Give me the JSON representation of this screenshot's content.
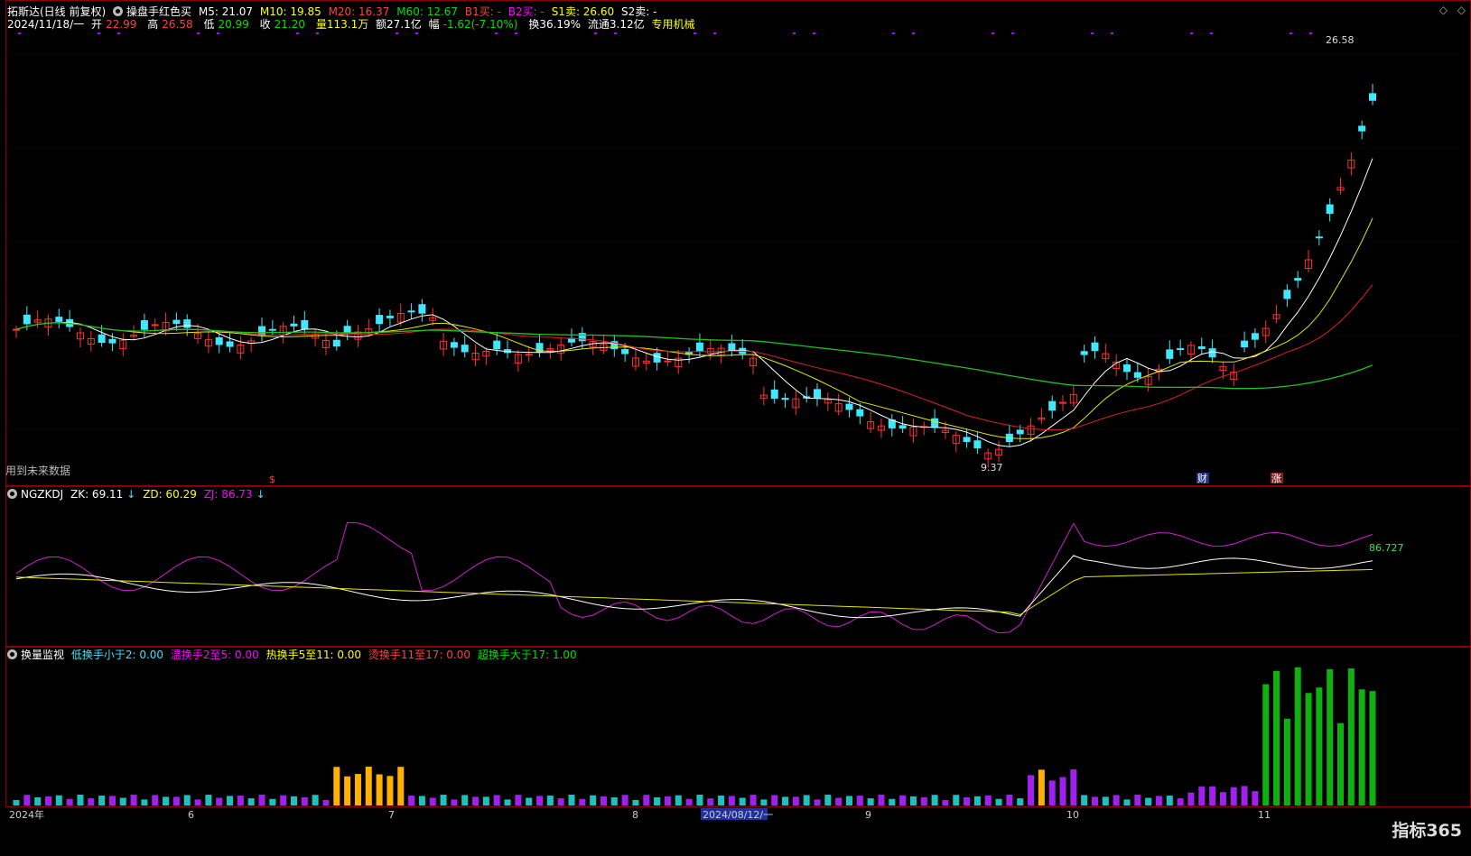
{
  "header": {
    "stock": "拓斯达(日线 前复权)",
    "indicator": "操盘手红色买",
    "m5": "M5: 21.07",
    "m10": "M10: 19.85",
    "m20": "M20: 16.37",
    "m60": "M60: 12.67",
    "b1": "B1买: -",
    "b2": "B2买: -",
    "s1": "S1卖: 26.60",
    "s2": "S2卖: -",
    "date": "2024/11/18/一",
    "open_label": "开",
    "open": "22.99",
    "high_label": "高",
    "high": "26.58",
    "low_label": "低",
    "low": "20.99",
    "close_label": "收",
    "close": "21.20",
    "vol": "量113.1万",
    "amount": "额27.1亿",
    "change_label": "幅",
    "change": "-1.62(-7.10%)",
    "turnover": "换36.19%",
    "float": "流通3.12亿",
    "sector": "专用机械"
  },
  "window_controls": {
    "diamond": "◇",
    "menu": "◇"
  },
  "notes": {
    "future": "用到未来数据",
    "high_label": "26.58",
    "low_label": "9.37",
    "marker_s": "$",
    "marker_cai": "财",
    "marker_zhang": "涨"
  },
  "panel2": {
    "name": "NGZKDJ",
    "zk": "ZK: 69.11",
    "zd": "ZD: 60.29",
    "zj": "ZJ: 86.73",
    "last": "86.727"
  },
  "panel3": {
    "name": "换量监视",
    "l1": "低换手小于2: 0.00",
    "l2": "温换手2至5: 0.00",
    "l3": "热换手5至11: 0.00",
    "l4": "烫换手11至17: 0.00",
    "l5": "超换手大于17: 1.00"
  },
  "xaxis": {
    "labels": [
      "2024年",
      "6",
      "7",
      "8",
      "2024/08/12/一",
      "9",
      "10",
      "11"
    ]
  },
  "logo": "指标365",
  "colors": {
    "up": "#ff3030",
    "down": "#40e8ff",
    "ma5": "#ffffff",
    "ma10": "#e6e600",
    "ma20": "#e02020",
    "ma60": "#20c020"
  },
  "chart_data": [
    {
      "type": "candlestick",
      "title": "拓斯达(日线 前复权)",
      "x": [
        "2024-05",
        "2024-06",
        "2024-07",
        "2024-08",
        "2024-09",
        "2024-10",
        "2024-11-18"
      ],
      "close": [
        14.8,
        14.1,
        14.6,
        13.9,
        10.0,
        13.5,
        21.2
      ],
      "high_marker": 26.58,
      "low_marker": 9.37,
      "series": [
        {
          "name": "M5",
          "last": 21.07
        },
        {
          "name": "M10",
          "last": 19.85
        },
        {
          "name": "M20",
          "last": 16.37
        },
        {
          "name": "M60",
          "last": 12.67
        }
      ]
    },
    {
      "type": "line",
      "title": "NGZKDJ",
      "x": [
        "2024-05",
        "2024-06",
        "2024-07",
        "2024-08",
        "2024-09",
        "2024-10",
        "2024-11-18"
      ],
      "series": [
        {
          "name": "ZK",
          "values": [
            55,
            48,
            52,
            40,
            30,
            62,
            69.11
          ]
        },
        {
          "name": "ZD",
          "values": [
            55,
            52,
            50,
            44,
            33,
            56,
            60.29
          ]
        },
        {
          "name": "ZJ",
          "values": [
            55,
            40,
            60,
            34,
            26,
            78,
            86.73
          ]
        }
      ]
    },
    {
      "type": "bar",
      "title": "换量监视",
      "x": [
        "2024-05",
        "2024-06",
        "2024-07",
        "2024-08",
        "2024-09",
        "2024-10",
        "2024-11-18"
      ],
      "series": [
        {
          "name": "低换手小于2",
          "last": 0.0
        },
        {
          "name": "温换手2至5",
          "last": 0.0
        },
        {
          "name": "热换手5至11",
          "last": 0.0
        },
        {
          "name": "烫换手11至17",
          "last": 0.0
        },
        {
          "name": "超换手大于17",
          "last": 1.0
        }
      ]
    }
  ]
}
